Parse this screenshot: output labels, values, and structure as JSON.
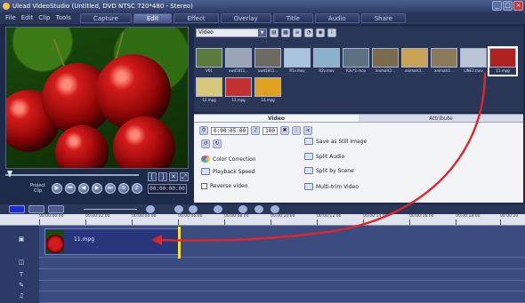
{
  "titlebar": {
    "title": "Ulead VideoStudio (Untitled, DVD NTSC 720*480 - Stereo)",
    "min": "_",
    "max": "□",
    "close": "×"
  },
  "menu": [
    "File",
    "Edit",
    "Clip",
    "Tools"
  ],
  "steps": [
    "Capture",
    "Edit",
    "Effect",
    "Overlay",
    "Title",
    "Audio",
    "Share"
  ],
  "preview": {
    "project_label": "Project",
    "clip_label": "Clip",
    "timecode": "00:00:00:00"
  },
  "library": {
    "category": "Video",
    "thumbs": [
      {
        "name": "V01",
        "color": "#5a7a3b"
      },
      {
        "name": "uwd1811...",
        "color": "#9aa6b8"
      },
      {
        "name": "uwd1811...",
        "color": "#6d6a61"
      },
      {
        "name": "R1v.mov",
        "color": "#a9c3dc"
      },
      {
        "name": "R2v.mov",
        "color": "#8bb0cc"
      },
      {
        "name": "R3v*1.mov",
        "color": "#5c7183"
      },
      {
        "name": "animals2...",
        "color": "#7b6a4e"
      },
      {
        "name": "animals3...",
        "color": "#c9a253"
      },
      {
        "name": "animals1...",
        "color": "#8a7a5a"
      },
      {
        "name": "LINE2.mov",
        "color": "#b9c4d6"
      },
      {
        "name": "11.mpg",
        "color": "#b02020"
      },
      {
        "name": "12.mpg",
        "color": "#d7c97b"
      },
      {
        "name": "13.mpg",
        "color": "#c23030"
      },
      {
        "name": "14.mpg",
        "color": "#e0a020"
      }
    ]
  },
  "options": {
    "tab_video": "Video",
    "tab_attribute": "Attribute",
    "duration": "0:00:05:00",
    "volume": "100",
    "color_correction": "Color Correction",
    "playback_speed": "Playback Speed",
    "reverse_video": "Reverse video",
    "save_still": "Save as Still Image",
    "split_audio": "Split Audio",
    "split_scene": "Split by Scene",
    "multi_trim": "Multi-trim Video"
  },
  "ruler": [
    "00:00:00:00",
    "00:00:02:00",
    "00:00:04:00",
    "00:00:06:00",
    "00:00:08:00",
    "00:00:10:00",
    "00:00:12:00",
    "00:00:14:00",
    "00:00:16:00",
    "00:00:18:00",
    "00:00:20"
  ],
  "clip": {
    "name": "11.mpg"
  },
  "colors": {
    "arrow": "#e0262a",
    "accent": "#1b2ad4"
  }
}
